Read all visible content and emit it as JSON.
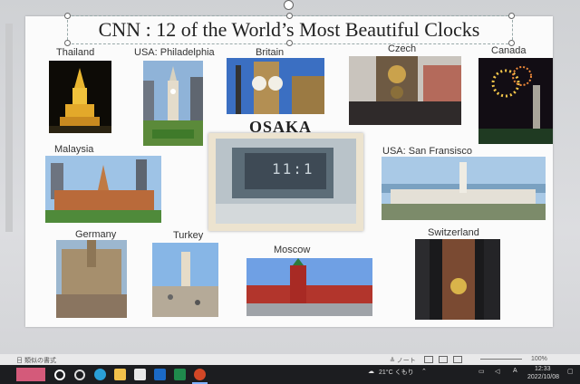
{
  "slide": {
    "title": "CNN : 12 of the World’s Most Beautiful Clocks",
    "center_label": "OSAKA",
    "center_clock_text": "11:1",
    "captions": {
      "thailand": "Thailand",
      "philadelphia": "USA: Philadelphia",
      "britain": "Britain",
      "czech": "Czech",
      "canada": "Canada",
      "malaysia": "Malaysia",
      "san_fransisco": "USA: San Fransisco",
      "germany": "Germany",
      "turkey": "Turkey",
      "moscow": "Moscow",
      "switzerland": "Switzerland"
    }
  },
  "statusbar": {
    "left": "日 類似の書式",
    "notes": "≜ ノート",
    "zoom": "100%"
  },
  "taskbar": {
    "weather": "21°C くもり",
    "time": "12:33",
    "date": "2022/10/08",
    "icons": [
      "start-icon",
      "search-icon",
      "task-view-icon",
      "edge-icon",
      "explorer-icon",
      "store-icon",
      "outlook-icon",
      "excel-icon",
      "powerpoint-icon"
    ]
  }
}
